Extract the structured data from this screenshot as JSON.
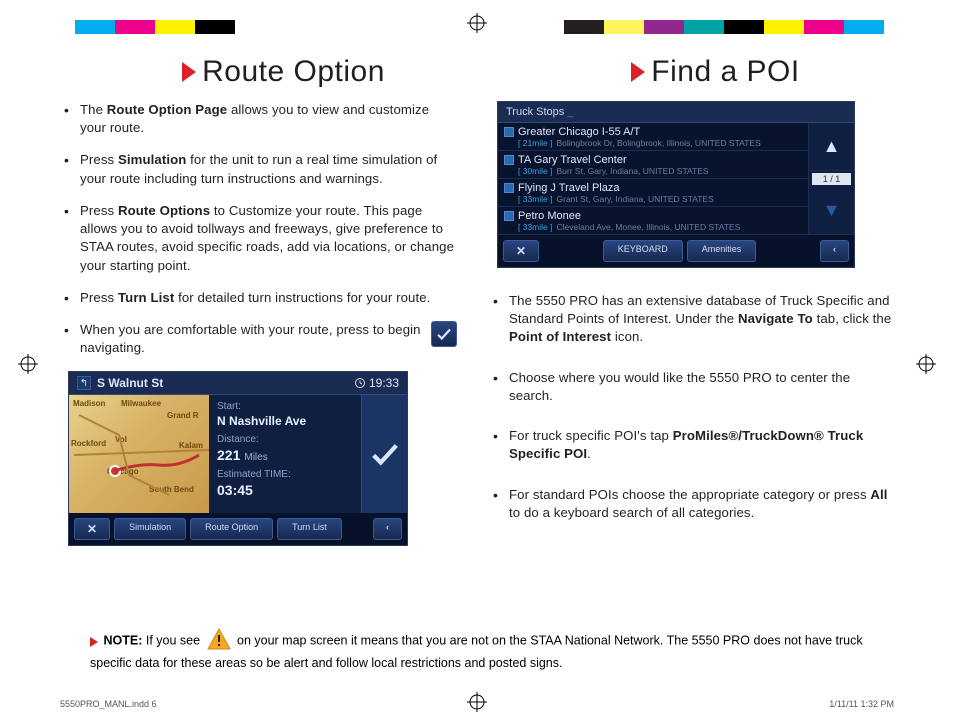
{
  "left": {
    "heading": "Route Option",
    "bullets": {
      "b1_pre": "The ",
      "b1_bold": "Route Option Page",
      "b1_post": " allows you to view and customize your route.",
      "b2_pre": "Press ",
      "b2_bold": "Simulation",
      "b2_post": " for the unit to run a real time simulation of your route including turn instructions and warnings.",
      "b3_pre": "Press ",
      "b3_bold": "Route Options",
      "b3_post": " to Customize your route. This page allows you to avoid tollways and freeways, give preference to STAA routes, avoid specific roads, add via locations, or change your starting point.",
      "b4_pre": "Press ",
      "b4_bold": "Turn List",
      "b4_post": " for detailed turn instructions for your route.",
      "b5": "When you are comfortable with your route, press to begin navigating."
    },
    "map_shot": {
      "street": "S Walnut St",
      "clock": "19:33",
      "start_lbl": "Start:",
      "start_val": "N Nashville Ave",
      "dist_lbl": "Distance:",
      "dist_val": "221",
      "dist_unit": "Miles",
      "eta_lbl": "Estimated TIME:",
      "eta_val": "03:45",
      "btn_x": "✕",
      "btn_sim": "Simulation",
      "btn_opt": "Route Option",
      "btn_turn": "Turn List",
      "btn_back": "‹",
      "cities": {
        "madison": "Madison",
        "milwaukee": "Milwaukee",
        "rockford": "Rockford",
        "chicago": "Chicago",
        "grandr": "Grand R",
        "kalam": "Kalam",
        "southbend": "South Bend",
        "vol": "Vol"
      }
    }
  },
  "right": {
    "heading": "Find a POI",
    "list_shot": {
      "title": "Truck Stops",
      "rows": [
        {
          "name": "Greater Chicago I-55 A/T",
          "dist": "[ 21mile ]",
          "addr": "Bolingbrook Dr, Bolingbrook, Illinois, UNITED STATES"
        },
        {
          "name": "TA Gary Travel Center",
          "dist": "[ 30mile ]",
          "addr": "Burr St, Gary, Indiana, UNITED STATES"
        },
        {
          "name": "Flying J Travel Plaza",
          "dist": "[ 33mile ]",
          "addr": "Grant St, Gary, Indiana, UNITED STATES"
        },
        {
          "name": "Petro Monee",
          "dist": "[ 33mile ]",
          "addr": "Cleveland Ave, Monee, Illinois, UNITED STATES"
        }
      ],
      "page": "1 / 1",
      "btn_x": "✕",
      "btn_kb": "KEYBOARD",
      "btn_am": "Amenities",
      "btn_back": "‹"
    },
    "bullets": {
      "b1_pre": "The 5550 PRO has an extensive database of Truck Specific and Standard Points of Interest. Under the ",
      "b1_bold1": "Navigate To",
      "b1_mid": " tab, click the ",
      "b1_bold2": "Point of Interest",
      "b1_post": " icon.",
      "b2": "Choose where you would like the 5550 PRO to center the search.",
      "b3_pre": "For truck specific POI's tap ",
      "b3_bold": "ProMiles®/TruckDown® Truck Specific POI",
      "b3_post": ".",
      "b4_pre": "For standard POIs choose the appropriate category or press ",
      "b4_bold": "All",
      "b4_post": " to do a keyboard search of all categories."
    }
  },
  "note": {
    "label": "NOTE:",
    "pre": " If you see ",
    "post": " on your map screen it means that you are not on the STAA National Network. The 5550 PRO does not have truck specific data for these areas so be alert and follow local restrictions and posted signs."
  },
  "footer": {
    "left": "5550PRO_MANL.indd   6",
    "right": "1/11/11   1:32 PM"
  }
}
